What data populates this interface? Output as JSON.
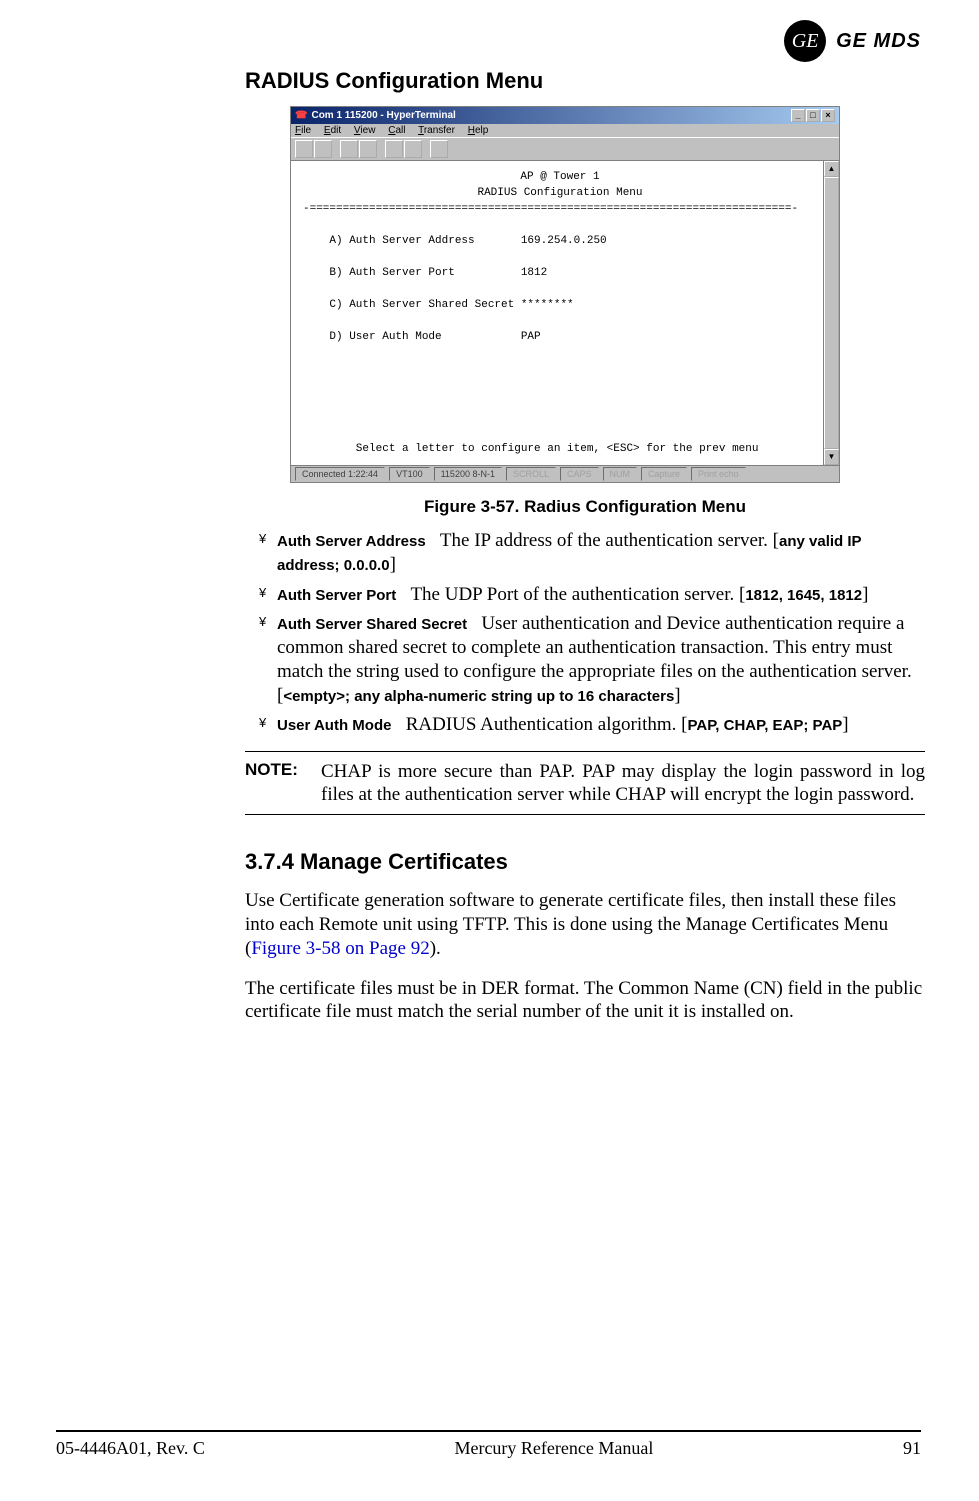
{
  "brand": {
    "logo_monogram": "GE",
    "logo_text": "GE MDS"
  },
  "section": {
    "title": "RADIUS Configuration Menu"
  },
  "terminal": {
    "window_title": "Com 1 115200 - HyperTerminal",
    "menu": {
      "file": "File",
      "edit": "Edit",
      "view": "View",
      "call": "Call",
      "transfer": "Transfer",
      "help": "Help"
    },
    "header1": "AP @ Tower 1",
    "header2": "RADIUS Configuration Menu",
    "rule": "-=========================================================================-",
    "lines": {
      "a": "    A) Auth Server Address       169.254.0.250",
      "b": "    B) Auth Server Port          1812",
      "c": "    C) Auth Server Shared Secret ********",
      "d": "    D) User Auth Mode            PAP"
    },
    "prompt": "        Select a letter to configure an item, <ESC> for the prev menu",
    "status": {
      "connected": "Connected 1:22:44",
      "emulation": "VT100",
      "settings": "115200 8-N-1",
      "scroll": "SCROLL",
      "caps": "CAPS",
      "num": "NUM",
      "capture": "Capture",
      "printecho": "Print echo"
    }
  },
  "figure_caption": "Figure 3-57. Radius Configuration Menu",
  "bullets": {
    "mark": "¥",
    "items": [
      {
        "label": "Auth Server Address",
        "desc_before": "The IP address of the authentication server. [",
        "param": "any valid IP address; 0.0.0.0",
        "desc_after": "]"
      },
      {
        "label": "Auth Server Port",
        "desc_before": "The UDP Port of the authentication server. [",
        "param": "1812, 1645, 1812",
        "desc_after": "]"
      },
      {
        "label": "Auth Server Shared Secret",
        "desc_before": "User authentication and Device authentication require a common shared secret to complete an authentication transaction. This entry must match the string used to configure the appropriate files on the authentication server.",
        "param_line_open": "[",
        "param": "<empty>; any alpha-numeric string up to 16 characters",
        "param_line_close": "]"
      },
      {
        "label": "User Auth Mode",
        "desc_before": "RADIUS Authentication algorithm. [",
        "param": "PAP, CHAP, EAP; PAP",
        "desc_after": "]"
      }
    ]
  },
  "note": {
    "label": "NOTE:",
    "text": "CHAP is more secure than PAP. PAP may display the login password in log files at the authentication server while CHAP will encrypt the login password."
  },
  "subsection": {
    "title": "3.7.4 Manage Certificates",
    "para1_before": "Use Certificate generation software to generate certificate files, then install these files into each Remote unit using TFTP. This is done using the Manage Certificates Menu (",
    "para1_link": "Figure 3-58 on Page 92",
    "para1_after": ").",
    "para2": "The certificate files must be in DER format. The Common Name (CN) field in the public certificate file must match the serial number of the unit it is installed on."
  },
  "footer": {
    "left": "05-4446A01, Rev. C",
    "center": "Mercury Reference Manual",
    "right": "91"
  }
}
